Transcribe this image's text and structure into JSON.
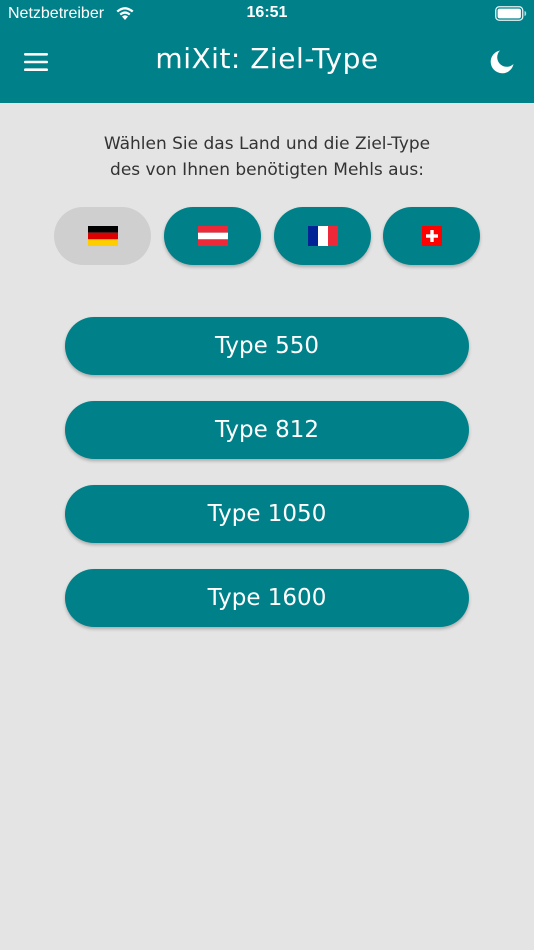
{
  "status_bar": {
    "carrier": "Netzbetreiber",
    "time": "16:51"
  },
  "header": {
    "title": "miXit: Ziel-Type",
    "menu_icon": "hamburger-menu-icon",
    "theme_icon": "moon-icon"
  },
  "instruction": {
    "line1": "Wählen Sie das Land und die Ziel-Type",
    "line2": "des von Ihnen benötigten Mehls aus:"
  },
  "countries": [
    {
      "id": "de",
      "flag_icon": "germany-flag-icon",
      "selected": true
    },
    {
      "id": "at",
      "flag_icon": "austria-flag-icon",
      "selected": false
    },
    {
      "id": "fr",
      "flag_icon": "france-flag-icon",
      "selected": false
    },
    {
      "id": "ch",
      "flag_icon": "switzerland-flag-icon",
      "selected": false
    }
  ],
  "types": [
    {
      "label": "Type 550"
    },
    {
      "label": "Type 812"
    },
    {
      "label": "Type 1050"
    },
    {
      "label": "Type 1600"
    }
  ],
  "colors": {
    "accent": "#00818a",
    "background": "#e4e4e4",
    "selected_chip": "#cfcfcf",
    "text": "#333333"
  }
}
